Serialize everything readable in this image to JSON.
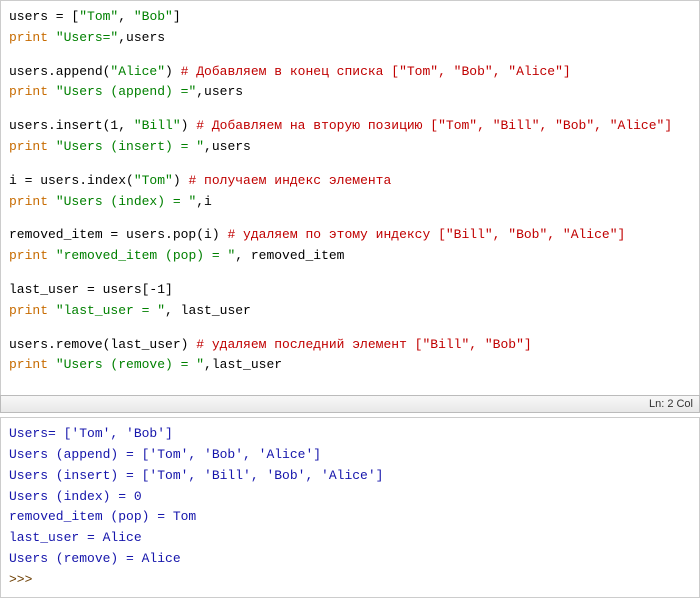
{
  "editor": {
    "l1": {
      "v": "users = [",
      "s1": "\"Tom\"",
      "p1": ", ",
      "s2": "\"Bob\"",
      "p2": "]"
    },
    "l2": {
      "k": "print",
      "s": " \"Users=\"",
      "n": ",users"
    },
    "l3": {
      "n1": "users.append(",
      "s1": "\"Alice\"",
      "n2": ")  ",
      "c": "# Добавляем в конец списка [\"Tom\", \"Bob\", \"Alice\"]"
    },
    "l4": {
      "k": "print",
      "s": " \"Users (append) =\"",
      "n": ",users"
    },
    "l5": {
      "n1": "users.insert(1, ",
      "s1": "\"Bill\"",
      "n2": ")    ",
      "c": "# Добавляем на вторую позицию [\"Tom\", \"Bill\", \"Bob\", \"Alice\"]"
    },
    "l6": {
      "k": "print",
      "s": " \"Users (insert) = \"",
      "n": ",users"
    },
    "l7": {
      "n1": "i = users.index(",
      "s1": "\"Tom\"",
      "n2": ")       ",
      "c": "# получаем индекс элемента"
    },
    "l8": {
      "k": "print",
      "s": " \"Users (index) = \"",
      "n": ",i"
    },
    "l9": {
      "n1": "removed_item = users.pop(i)    ",
      "c": "# удаляем по этому индексу [\"Bill\", \"Bob\", \"Alice\"]"
    },
    "l10": {
      "k": "print",
      "s": " \"removed_item (pop) = \"",
      "n": ", removed_item"
    },
    "l11": {
      "n": "last_user = users[-1]"
    },
    "l12": {
      "k": "print",
      "s": " \"last_user = \"",
      "n": ", last_user"
    },
    "l13": {
      "n1": "users.remove(last_user)         ",
      "c": "# удаляем последний элемент [\"Bill\", \"Bob\"]"
    },
    "l14": {
      "k": "print",
      "s": " \"Users (remove) = \"",
      "n": ",last_user"
    }
  },
  "status": {
    "text": "Ln: 2   Col"
  },
  "output": {
    "o1": "Users= ['Tom', 'Bob']",
    "o2": "Users (append) = ['Tom', 'Bob', 'Alice']",
    "o3": "Users (insert) =  ['Tom', 'Bill', 'Bob', 'Alice']",
    "o4": "Users (index) =  0",
    "o5": "removed_item (pop) =  Tom",
    "o6": "last_user =  Alice",
    "o7": "Users (remove) =  Alice",
    "prompt": ">>> "
  }
}
